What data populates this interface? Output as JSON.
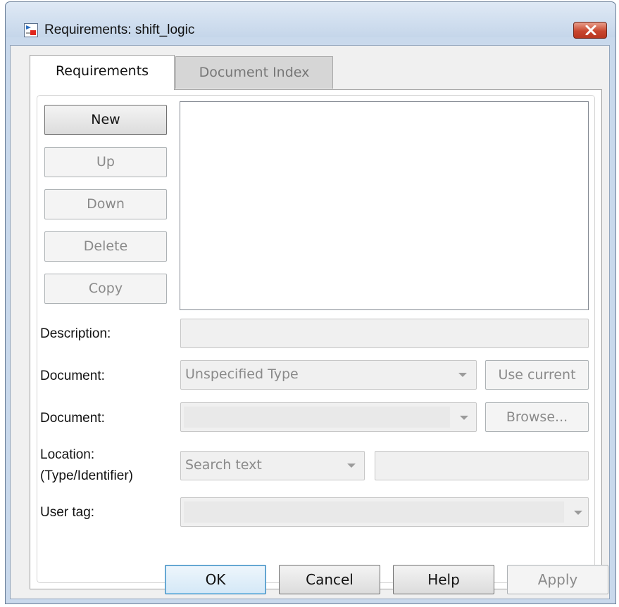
{
  "window": {
    "title": "Requirements: shift_logic"
  },
  "tabs": [
    {
      "label": "Requirements",
      "active": true
    },
    {
      "label": "Document Index",
      "active": false
    }
  ],
  "side_buttons": {
    "new": "New",
    "up": "Up",
    "down": "Down",
    "delete": "Delete",
    "copy": "Copy"
  },
  "form": {
    "description_label": "Description:",
    "description_value": "",
    "document_type_label": "Document:",
    "document_type_value": "Unspecified Type",
    "use_current_label": "Use current",
    "document_label": "Document:",
    "document_value": "",
    "browse_label": "Browse...",
    "location_label_line1": "Location:",
    "location_label_line2": "(Type/Identifier)",
    "location_type_value": "Search text",
    "location_identifier_value": "",
    "user_tag_label": "User tag:",
    "user_tag_value": ""
  },
  "footer": {
    "ok": "OK",
    "cancel": "Cancel",
    "help": "Help",
    "apply": "Apply"
  },
  "colors": {
    "window_frame": "#c9d9ec",
    "close_button": "#c9472f",
    "ok_border": "#3c7fb1",
    "disabled_text": "#8a8a8a"
  }
}
